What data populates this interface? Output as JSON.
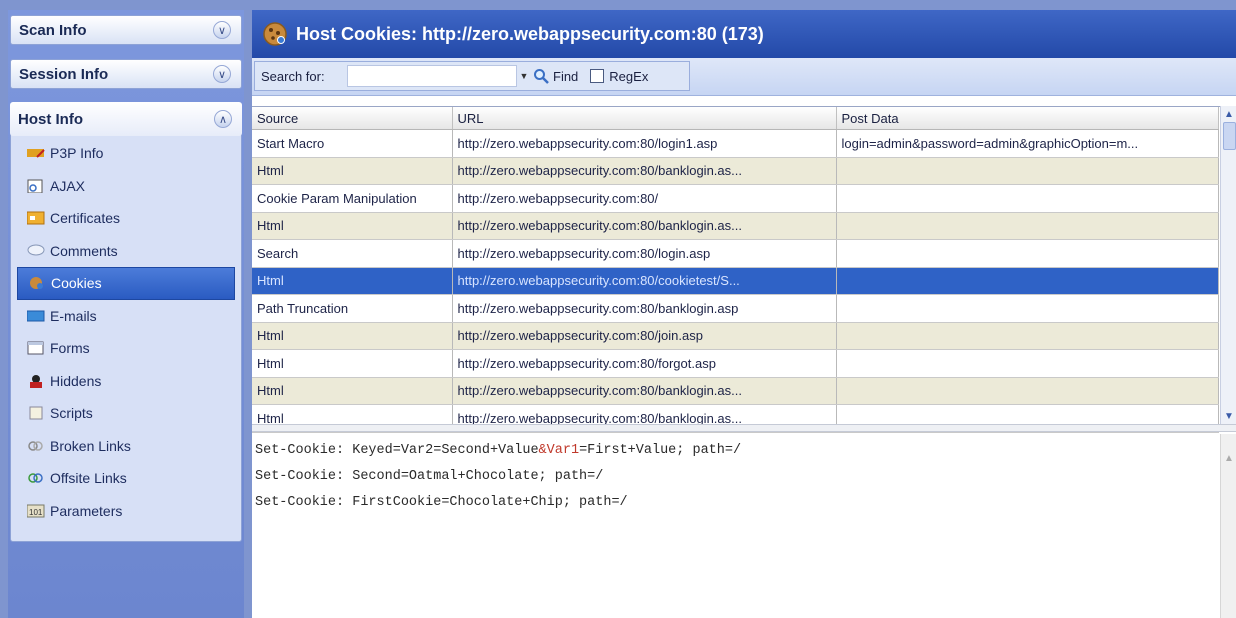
{
  "sidebar": {
    "scan_info": "Scan Info",
    "session_info": "Session Info",
    "host_info": "Host Info",
    "items": [
      {
        "label": "P3P Info",
        "icon": "p3p-icon"
      },
      {
        "label": "AJAX",
        "icon": "ajax-icon"
      },
      {
        "label": "Certificates",
        "icon": "certificate-icon"
      },
      {
        "label": "Comments",
        "icon": "comment-icon"
      },
      {
        "label": "Cookies",
        "icon": "cookie-icon"
      },
      {
        "label": "E-mails",
        "icon": "email-icon"
      },
      {
        "label": "Forms",
        "icon": "form-icon"
      },
      {
        "label": "Hiddens",
        "icon": "hidden-icon"
      },
      {
        "label": "Scripts",
        "icon": "script-icon"
      },
      {
        "label": "Broken Links",
        "icon": "broken-link-icon"
      },
      {
        "label": "Offsite Links",
        "icon": "offsite-link-icon"
      },
      {
        "label": "Parameters",
        "icon": "parameters-icon"
      }
    ],
    "selected_index": 4
  },
  "header": {
    "title": "Host Cookies: http://zero.webappsecurity.com:80 (173)"
  },
  "search": {
    "label": "Search for:",
    "value": "",
    "find_label": "Find",
    "regex_label": "RegEx",
    "regex_checked": false
  },
  "table": {
    "columns": [
      "Source",
      "URL",
      "Post Data"
    ],
    "rows": [
      [
        "Start Macro",
        "http://zero.webappsecurity.com:80/login1.asp",
        "login=admin&password=admin&graphicOption=m..."
      ],
      [
        "Html",
        "http://zero.webappsecurity.com:80/banklogin.as...",
        ""
      ],
      [
        "Cookie Param Manipulation",
        "http://zero.webappsecurity.com:80/",
        ""
      ],
      [
        "Html",
        "http://zero.webappsecurity.com:80/banklogin.as...",
        ""
      ],
      [
        "Search",
        "http://zero.webappsecurity.com:80/login.asp",
        ""
      ],
      [
        "Html",
        "http://zero.webappsecurity.com:80/cookietest/S...",
        ""
      ],
      [
        "Path Truncation",
        "http://zero.webappsecurity.com:80/banklogin.asp",
        ""
      ],
      [
        "Html",
        "http://zero.webappsecurity.com:80/join.asp",
        ""
      ],
      [
        "Html",
        "http://zero.webappsecurity.com:80/forgot.asp",
        ""
      ],
      [
        "Html",
        "http://zero.webappsecurity.com:80/banklogin.as...",
        ""
      ],
      [
        "Html",
        "http://zero.webappsecurity.com:80/banklogin.as...",
        ""
      ]
    ],
    "selected_row": 5
  },
  "raw": {
    "line1_prefix": "Set-Cookie: Keyed=Var2=Second+Value",
    "line1_highlight": "&Var1",
    "line1_suffix": "=First+Value; path=/",
    "line2": "Set-Cookie: Second=Oatmal+Chocolate; path=/",
    "line3": "Set-Cookie: FirstCookie=Chocolate+Chip; path=/"
  },
  "colors": {
    "title_bar": "#2d55b5",
    "selection": "#2f62c6",
    "sidebar_bg": "#7d97dd",
    "highlight_text": "#c0392b"
  }
}
